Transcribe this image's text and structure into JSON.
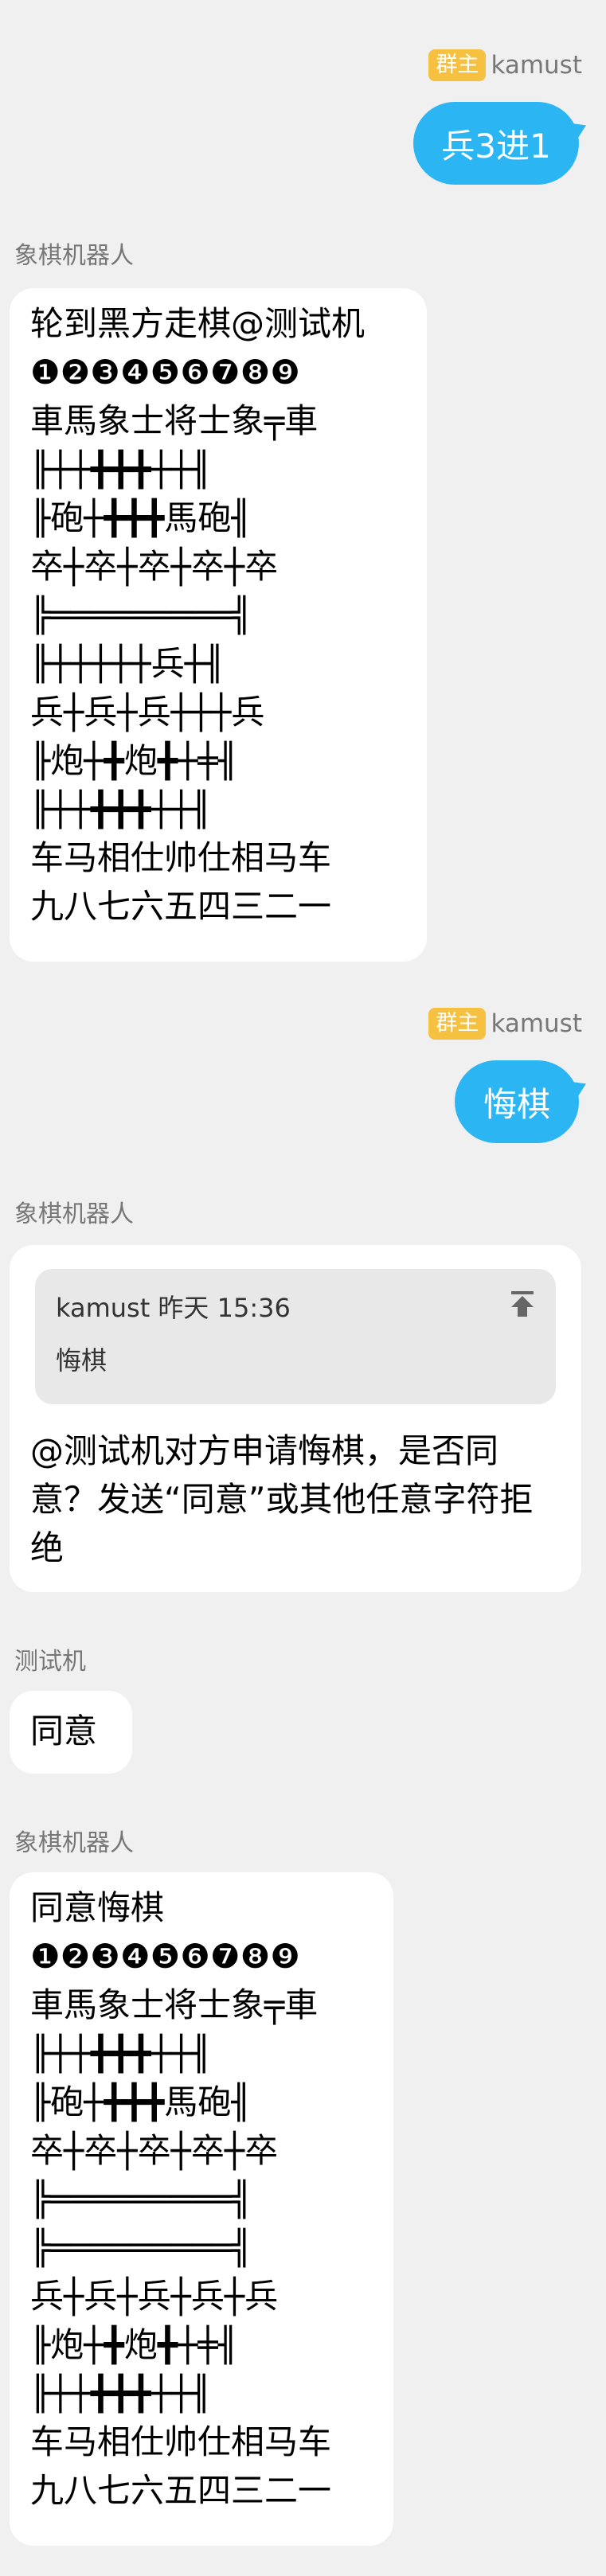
{
  "badge_label": "群主",
  "owner_name": "kamust",
  "bot_name": "象棋机器人",
  "tester_name": "测试机",
  "msg1_text": "兵3进1",
  "msg2": {
    "lines": [
      "轮到黑方走棋@测试机",
      "❶❷❸❹❺❻❼❽❾",
      "車馬象士将士象╤車",
      "╟┼┼╋╋╋┼┼╢",
      "╟砲┼╋╋╋馬砲╢",
      "卒┼卒┼卒┼卒┼卒",
      "╠═════════╣",
      "╟┼┼┼┼┼兵┼╢",
      "兵┼兵┼兵┼┼┼兵",
      "╟炮┼╋炮╋┼╪╢",
      "╟┼┼╋╋╋┼┼╢",
      "车马相仕帅仕相马车",
      "九八七六五四三二一"
    ]
  },
  "msg3_text": "悔棋",
  "msg4": {
    "quote_header": "kamust 昨天 15:36",
    "quote_body": "悔棋",
    "reply_text": "@测试机对方申请悔棋，是否同意？发送“同意”或其他任意字符拒绝"
  },
  "msg5_text": "同意",
  "msg6": {
    "lines": [
      "同意悔棋",
      "❶❷❸❹❺❻❼❽❾",
      "車馬象士将士象╤車",
      "╟┼┼╋╋╋┼┼╢",
      "╟砲┼╋╋╋馬砲╢",
      "卒┼卒┼卒┼卒┼卒",
      "╠═════════╣",
      "╠═════════╣",
      "兵┼兵┼兵┼兵┼兵",
      "╟炮┼╋炮╋┼╪╢",
      "╟┼┼╋╋╋┼┼╢",
      "车马相仕帅仕相马车",
      "九八七六五四三二一"
    ]
  },
  "colors": {
    "background": "#f0f0f0",
    "outgoing_bubble": "#2bb6f3",
    "badge": "#f6c141",
    "incoming_bubble": "#ffffff",
    "quote_box": "#e8e8e8"
  }
}
